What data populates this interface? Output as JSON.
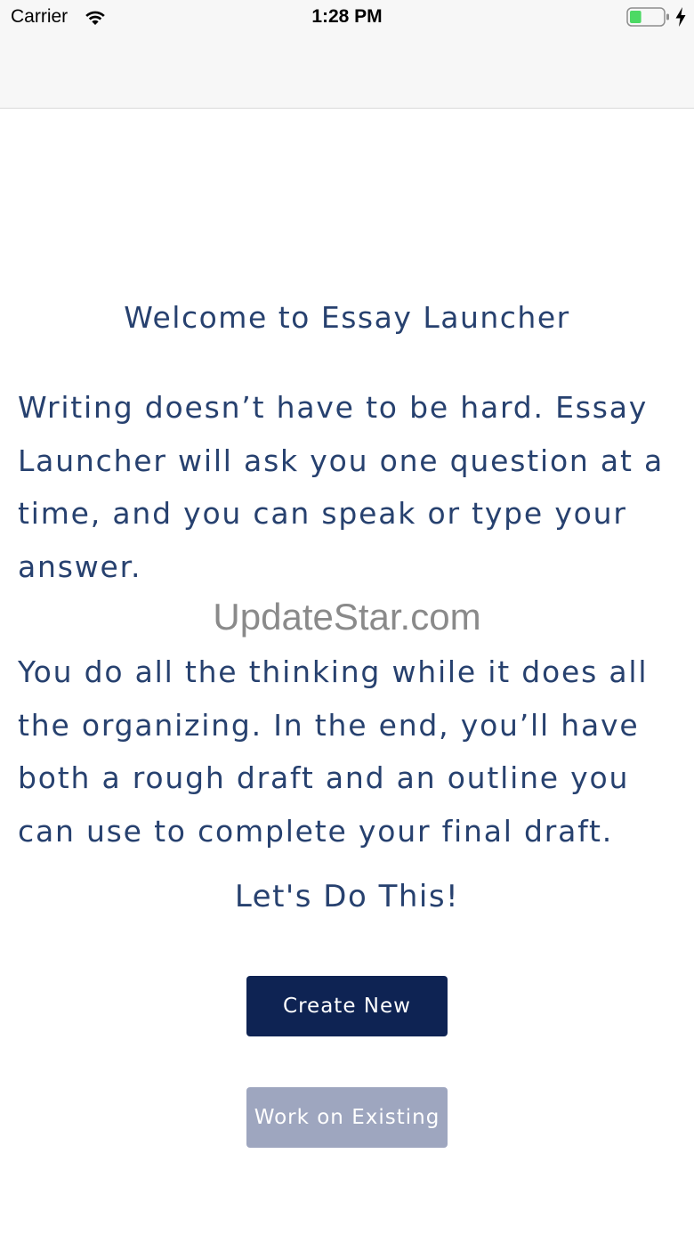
{
  "status_bar": {
    "carrier": "Carrier",
    "time": "1:28 PM",
    "battery_level": 0.35,
    "battery_color": "#4cd964",
    "charging": true
  },
  "content": {
    "title": "Welcome to Essay Launcher",
    "paragraph1": "Writing doesn’t have to be hard.  Essay Launcher will ask you one question at a time, and you can speak or type your answer.",
    "paragraph2": "You do all the thinking while it does all the organizing. In the end, you’ll have both a rough draft and an outline you can use to complete your final draft.",
    "watermark": "UpdateStar.com",
    "cta": "Let's Do This!"
  },
  "buttons": {
    "create_new": "Create New",
    "work_on_existing": "Work on Existing"
  },
  "colors": {
    "text": "#27416f",
    "primary_button": "#0e2353",
    "disabled_button": "#9ea6bf"
  },
  "icons": [
    "wifi-icon",
    "battery-icon",
    "charging-icon"
  ]
}
